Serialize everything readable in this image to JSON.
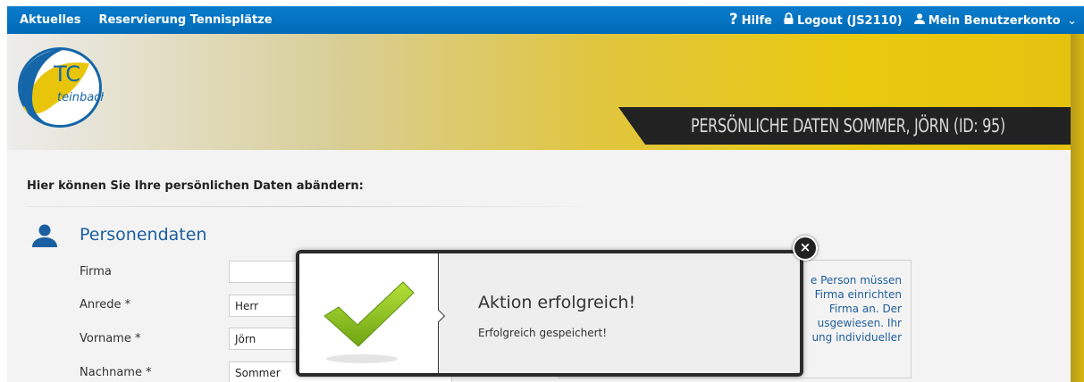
{
  "nav": {
    "aktuelles": "Aktuelles",
    "reservierung": "Reservierung Tennisplätze",
    "hilfe": "Hilfe",
    "logout": "Logout (JS2110)",
    "konto": "Mein Benutzerkonto"
  },
  "header": {
    "logo_text_top": "TC",
    "logo_text_bottom": "teinbach",
    "title": "PERSÖNLICHE DATEN  SOMMER, JÖRN (ID: 95)"
  },
  "content": {
    "intro": "Hier können Sie Ihre persönlichen Daten abändern:",
    "section_title": "Personendaten",
    "fields": [
      {
        "label": "Firma",
        "value": ""
      },
      {
        "label": "Anrede *",
        "value": "Herr"
      },
      {
        "label": "Vorname *",
        "value": "Jörn"
      },
      {
        "label": "Nachname *",
        "value": "Sommer"
      }
    ],
    "info_lines": [
      "e Person müssen",
      "Firma einrichten",
      "Firma an. Der",
      "usgewiesen. Ihr",
      "ung individueller"
    ]
  },
  "modal": {
    "title": "Aktion erfolgreich!",
    "message": "Erfolgreich gespeichert!",
    "close": "×"
  },
  "colors": {
    "nav_bg": "#0a7ccc",
    "accent_blue": "#1a5fa0",
    "header_yellow": "#e9c90e",
    "check_green": "#8cc21d"
  }
}
